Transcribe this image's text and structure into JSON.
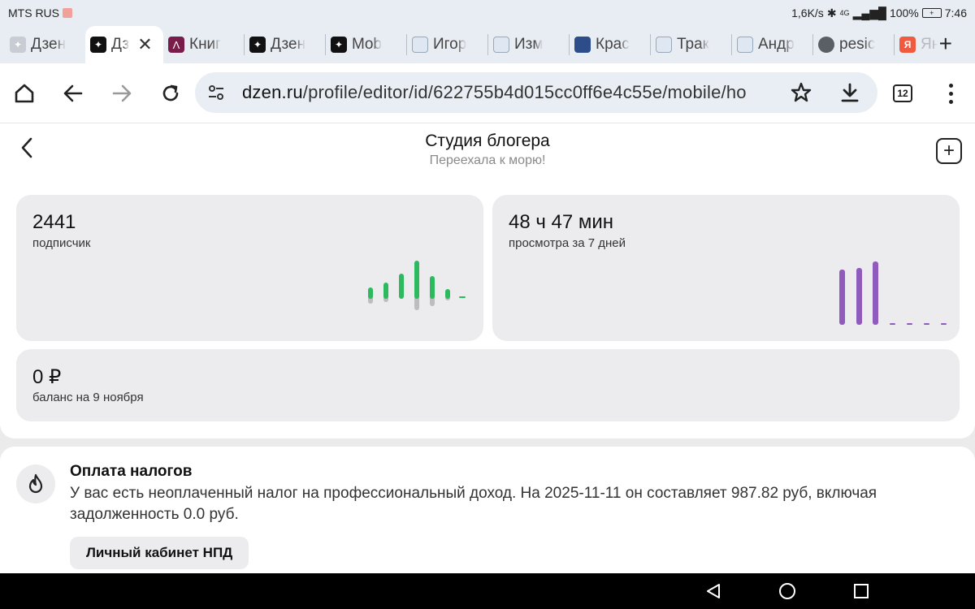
{
  "status_bar": {
    "carrier": "MTS RUS",
    "speed": "1,6K/s",
    "network": "4G",
    "battery": "100%",
    "time": "7:46"
  },
  "tabs": [
    {
      "label": "Дзен",
      "icon": "dzen-light-icon",
      "active": false
    },
    {
      "label": "Дз",
      "icon": "dzen-icon",
      "active": true
    },
    {
      "label": "Книг",
      "icon": "book-icon",
      "active": false
    },
    {
      "label": "Дзен",
      "icon": "dzen-icon",
      "active": false
    },
    {
      "label": "Mob",
      "icon": "dzen-icon",
      "active": false
    },
    {
      "label": "Игор",
      "icon": "ship-icon",
      "active": false
    },
    {
      "label": "Изм",
      "icon": "ship-icon",
      "active": false
    },
    {
      "label": "Крас",
      "icon": "crest-icon",
      "active": false
    },
    {
      "label": "Трак",
      "icon": "ship-icon",
      "active": false
    },
    {
      "label": "Андр",
      "icon": "ship-icon",
      "active": false
    },
    {
      "label": "pesic",
      "icon": "globe-icon",
      "active": false
    },
    {
      "label": "Ян",
      "icon": "yandex-icon",
      "active": false
    }
  ],
  "tab_count": "12",
  "address_bar": {
    "host": "dzen.ru",
    "path": "/profile/editor/id/622755b4d015cc0ff6e4c55e/mobile/ho"
  },
  "page": {
    "title": "Студия блогера",
    "subtitle": "Переехала к морю!"
  },
  "stats": {
    "subscribers": {
      "value": "2441",
      "label": "подписчик"
    },
    "views": {
      "value": "48 ч 47 мин",
      "label": "просмотра за 7 дней"
    },
    "balance": {
      "value": "0 ₽",
      "label": "баланс на 9 ноября"
    }
  },
  "tax": {
    "title": "Оплата налогов",
    "text": "У вас есть неоплаченный налог на профессиональный доход. На 2025-11-11 он составляет 987.82 руб, включая задолженность 0.0 руб.",
    "button": "Личный кабинет НПД"
  },
  "colors": {
    "green": "#2dba5e",
    "purple": "#8f5bbd",
    "card_bg": "#ececef"
  }
}
